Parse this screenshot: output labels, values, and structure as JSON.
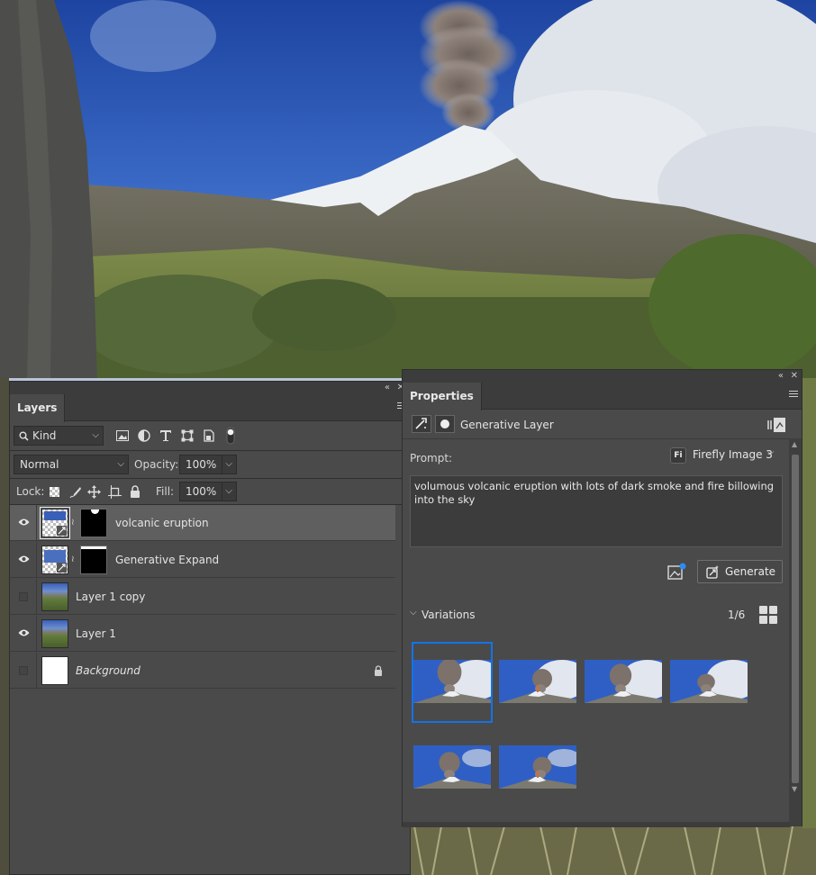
{
  "layers_panel": {
    "tab_label": "Layers",
    "filter_kind": "Kind",
    "blend_mode": "Normal",
    "opacity_label": "Opacity:",
    "opacity_value": "100%",
    "lock_label": "Lock:",
    "fill_label": "Fill:",
    "fill_value": "100%",
    "layers": [
      {
        "name": "volcanic eruption",
        "visible": true,
        "selected": true,
        "has_mask": true
      },
      {
        "name": "Generative Expand",
        "visible": true,
        "selected": false,
        "has_mask": true
      },
      {
        "name": "Layer 1 copy",
        "visible": false,
        "selected": false,
        "has_mask": false
      },
      {
        "name": "Layer 1",
        "visible": true,
        "selected": false,
        "has_mask": false
      },
      {
        "name": "Background",
        "visible": false,
        "selected": false,
        "has_mask": false,
        "locked": true
      }
    ]
  },
  "properties_panel": {
    "tab_label": "Properties",
    "layer_type": "Generative Layer",
    "prompt_label": "Prompt:",
    "model_badge": "Fi",
    "model_name": "Firefly Image 3",
    "prompt_text": "volumous volcanic eruption with lots of dark smoke and fire billowing into the sky",
    "generate_label": "Generate",
    "variations_label": "Variations",
    "variation_counter": "1/6",
    "variation_count": 6,
    "selected_variation": 1
  },
  "colors": {
    "panel_bg": "#4a4a4a",
    "tab_bar_bg": "#3c3c3c",
    "selected_layer_bg": "#5f5f5f",
    "accent_blue": "#1473e6",
    "text": "#d6d6d6"
  },
  "icons": [
    "search-icon",
    "chevron-down-icon",
    "image-filter-icon",
    "adjustment-filter-icon",
    "type-filter-icon",
    "shape-filter-icon",
    "smart-object-filter-icon",
    "filter-toggle-icon",
    "lock-transparent-icon",
    "lock-pixels-icon",
    "lock-position-icon",
    "lock-artboard-icon",
    "lock-all-icon",
    "eye-icon",
    "link-icon",
    "lock-icon",
    "generative-layer-icon",
    "mask-icon",
    "panel-menu-icon",
    "collapse-icon",
    "close-icon",
    "reference-image-icon",
    "generate-icon",
    "grid-view-icon"
  ]
}
